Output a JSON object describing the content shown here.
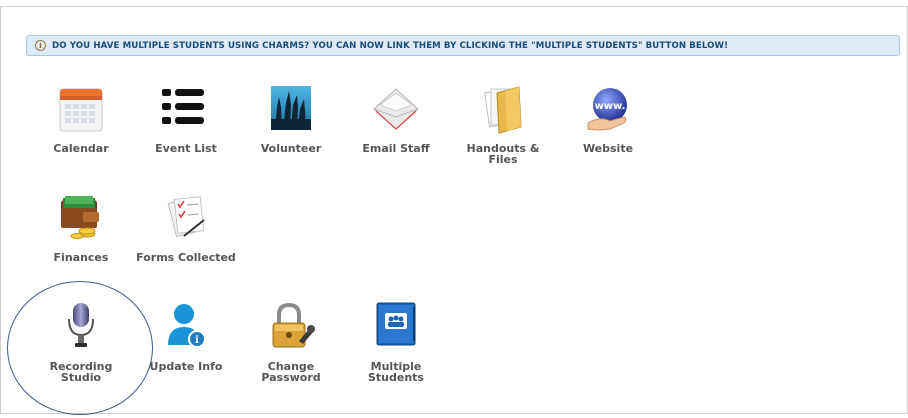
{
  "banner": {
    "icon": "info-icon",
    "text": "DO YOU HAVE MULTIPLE STUDENTS USING CHARMS? YOU CAN NOW LINK THEM BY CLICKING THE \"MULTIPLE STUDENTS\" BUTTON BELOW!"
  },
  "tiles": [
    {
      "label": "Calendar",
      "icon": "calendar-icon"
    },
    {
      "label": "Event List",
      "icon": "event-list-icon"
    },
    {
      "label": "Volunteer",
      "icon": "volunteer-icon"
    },
    {
      "label": "Email Staff",
      "icon": "email-icon"
    },
    {
      "label": "Handouts & Files",
      "icon": "folder-icon"
    },
    {
      "label": "Website",
      "icon": "globe-icon"
    },
    {
      "label": "Finances",
      "icon": "wallet-icon"
    },
    {
      "label": "Forms Collected",
      "icon": "forms-icon"
    },
    {
      "label": "Recording\nStudio",
      "icon": "microphone-icon"
    },
    {
      "label": "Update Info",
      "icon": "user-info-icon"
    },
    {
      "label": "Change\nPassword",
      "icon": "padlock-icon"
    },
    {
      "label": "Multiple\nStudents",
      "icon": "multiple-students-icon"
    }
  ],
  "colors": {
    "banner_bg": "#deeaf5",
    "banner_text": "#174e79",
    "label_text": "#555555",
    "highlight_circle": "#3c5d86"
  }
}
